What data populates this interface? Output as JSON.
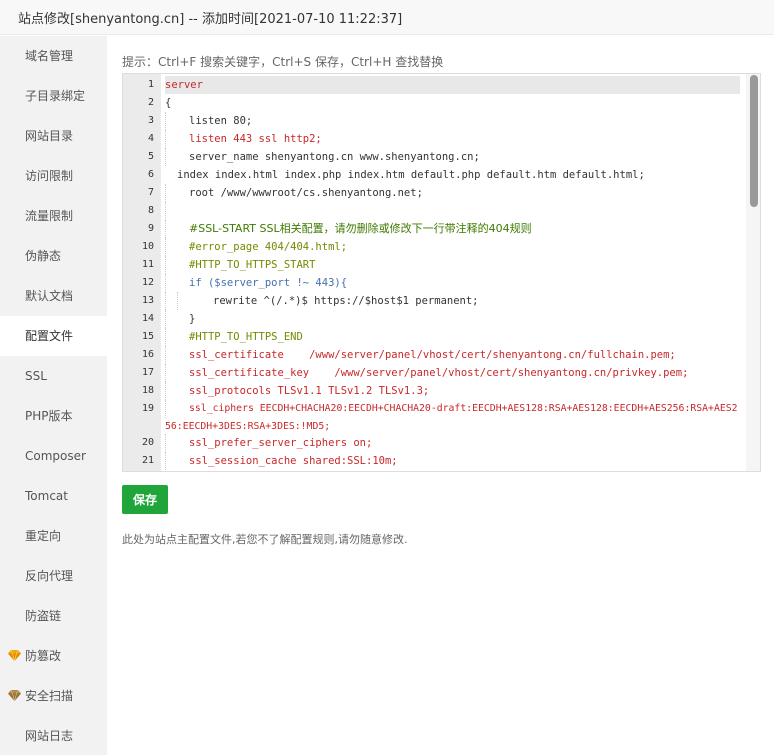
{
  "window": {
    "title": "站点修改[shenyantong.cn] -- 添加时间[2021-07-10 11:22:37]"
  },
  "sidebar": {
    "items": [
      {
        "label": "域名管理"
      },
      {
        "label": "子目录绑定"
      },
      {
        "label": "网站目录"
      },
      {
        "label": "访问限制"
      },
      {
        "label": "流量限制"
      },
      {
        "label": "伪静态"
      },
      {
        "label": "默认文档"
      },
      {
        "label": "配置文件",
        "active": true
      },
      {
        "label": "SSL"
      },
      {
        "label": "PHP版本"
      },
      {
        "label": "Composer"
      },
      {
        "label": "Tomcat"
      },
      {
        "label": "重定向"
      },
      {
        "label": "反向代理"
      },
      {
        "label": "防盗链"
      },
      {
        "label": "防篡改",
        "icon": "gold-diamond-icon",
        "icon_color": "#f3a50a"
      },
      {
        "label": "安全扫描",
        "icon": "bronze-diamond-icon",
        "icon_color": "#b08a4a"
      },
      {
        "label": "网站日志"
      }
    ]
  },
  "editor": {
    "hint": "提示：Ctrl+F 搜索关键字，Ctrl+S 保存，Ctrl+H 查找替换",
    "lines": [
      {
        "n": "1",
        "text": "server"
      },
      {
        "n": "2",
        "text": "{"
      },
      {
        "n": "3",
        "text": "listen 80;"
      },
      {
        "n": "4",
        "text": "listen 443 ssl http2;"
      },
      {
        "n": "5",
        "text": "server_name shenyantong.cn www.shenyantong.cn;"
      },
      {
        "n": "6",
        "text": "index index.html index.php index.htm default.php default.htm default.html;"
      },
      {
        "n": "7",
        "text": "root /www/wwwroot/cs.shenyantong.net;"
      },
      {
        "n": "8",
        "text": ""
      },
      {
        "n": "9",
        "text": "#SSL-START SSL相关配置，请勿删除或修改下一行带注释的404规则"
      },
      {
        "n": "10",
        "text": "#error_page 404/404.html;"
      },
      {
        "n": "11",
        "text": "#HTTP_TO_HTTPS_START"
      },
      {
        "n": "12",
        "text": "if ($server_port !~ 443){"
      },
      {
        "n": "13",
        "text": "rewrite ^(/.*)$ https://$host$1 permanent;"
      },
      {
        "n": "14",
        "text": "}"
      },
      {
        "n": "15",
        "text": "#HTTP_TO_HTTPS_END"
      },
      {
        "n": "16",
        "text": "ssl_certificate    /www/server/panel/vhost/cert/shenyantong.cn/fullchain.pem;"
      },
      {
        "n": "17",
        "text": "ssl_certificate_key    /www/server/panel/vhost/cert/shenyantong.cn/privkey.pem;"
      },
      {
        "n": "18",
        "text": "ssl_protocols TLSv1.1 TLSv1.2 TLSv1.3;"
      },
      {
        "n": "19",
        "text": "ssl_ciphers EECDH+CHACHA20:EECDH+CHACHA20-draft:EECDH+AES128:RSA+AES128:EECDH+AES256:RSA+AES256:EECDH+3DES:RSA+3DES:!MD5;"
      },
      {
        "n": "20",
        "text": "ssl_prefer_server_ciphers on;"
      },
      {
        "n": "21",
        "text": "ssl_session_cache shared:SSL:10m;"
      }
    ]
  },
  "actions": {
    "save_label": "保存"
  },
  "footer": {
    "note": "此处为站点主配置文件,若您不了解配置规则,请勿随意修改."
  },
  "colors": {
    "accent": "#20a53a",
    "keyword": "#c82829",
    "function": "#4271ae",
    "comment": "#718c00",
    "variable": "#8959a8"
  }
}
